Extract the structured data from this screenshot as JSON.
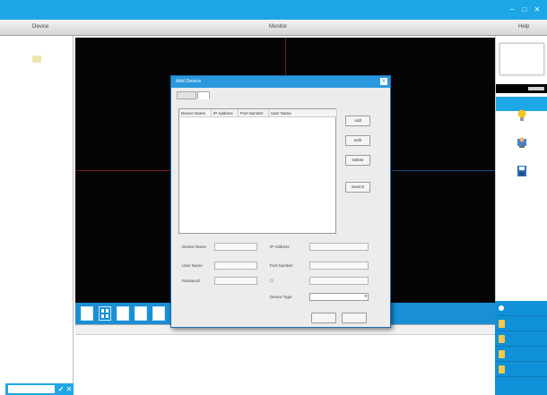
{
  "window": {
    "app_title": "",
    "min_glyph": "−",
    "max_glyph": "□",
    "close_glyph": "✕"
  },
  "header": {
    "left_label": "Device",
    "center_label": "Monitor",
    "right_label": "Help"
  },
  "clock": {
    "time": "",
    "date": "",
    "weekday": ""
  },
  "right_panel": {
    "header": "",
    "tools": [
      {
        "icon": "bulb-icon",
        "label": ""
      },
      {
        "icon": "person-monitor-icon",
        "label": ""
      },
      {
        "icon": "disk-icon",
        "label": ""
      }
    ]
  },
  "right_menu": [
    {
      "label": ""
    },
    {
      "label": ""
    },
    {
      "label": ""
    },
    {
      "label": ""
    },
    {
      "label": ""
    }
  ],
  "table_columns": [
    "",
    "",
    "",
    "",
    "",
    "",
    "",
    "",
    "",
    ""
  ],
  "search": {
    "placeholder": "",
    "go_glyph": "✓",
    "clear_glyph": "✕"
  },
  "dialog": {
    "title": "Add Device",
    "tabs": [
      "",
      ""
    ],
    "section_label": "",
    "list_columns": [
      "Device Name",
      "IP Address",
      "Port Number",
      "User Name"
    ],
    "buttons": {
      "add": "Add",
      "edit": "Edit",
      "delete": "Delete",
      "search": "Search",
      "ok": "",
      "cancel": ""
    },
    "fields": {
      "device_name_label": "Device Name",
      "ip_address_label": "IP Address",
      "user_name_label": "User Name",
      "port_number_label": "Port Number",
      "password_label": "Password",
      "device_type_label": "Device Type",
      "ip_value": "",
      "user_value": "",
      "device_type_value": ""
    }
  },
  "colors": {
    "accent": "#1ea7e6",
    "video_bg": "#050505",
    "grid_line": "#7a1a1a"
  }
}
